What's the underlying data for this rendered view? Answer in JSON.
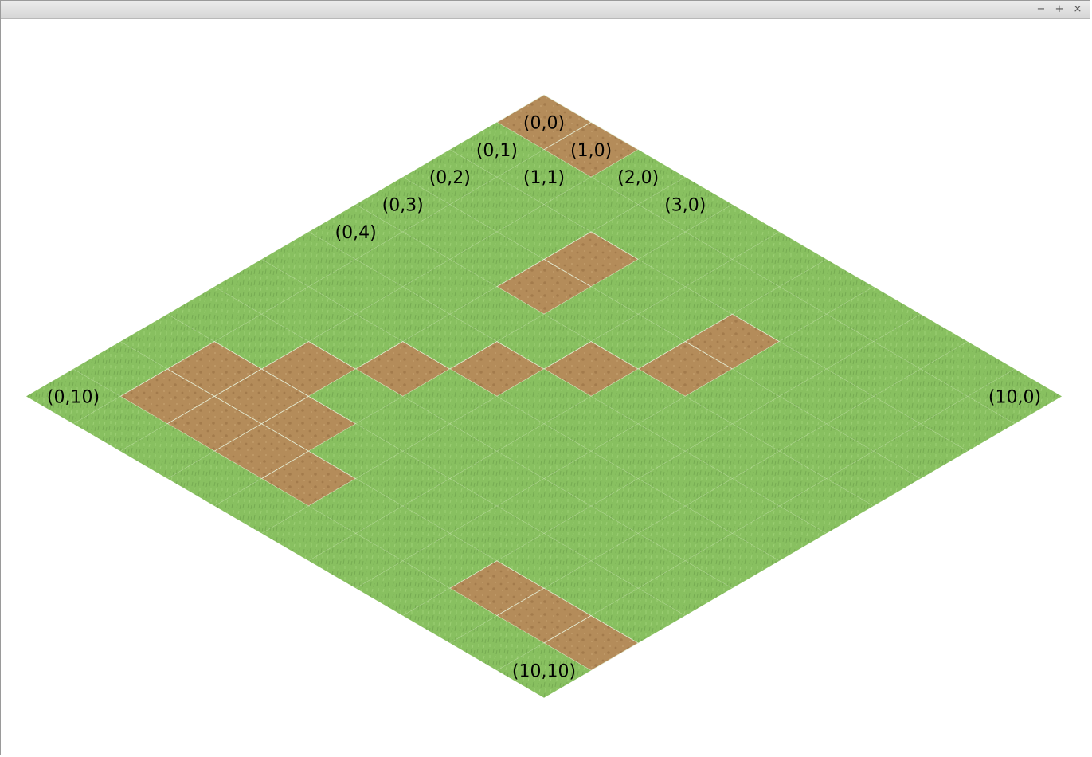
{
  "window": {
    "minimize_icon": "−",
    "maximize_icon": "+",
    "close_icon": "×"
  },
  "map": {
    "grid_size": 10,
    "colors": {
      "grass": "#88c060",
      "grass_dark": "#7aae55",
      "grass_light": "#98cc70",
      "dirt": "#b48c5a",
      "dirt_dark": "#a07a4c",
      "grid_line": "#e9f3dc"
    },
    "dirt_tiles": [
      [
        0,
        0
      ],
      [
        1,
        0
      ],
      [
        3,
        2
      ],
      [
        3,
        3
      ],
      [
        6,
        2
      ],
      [
        6,
        3
      ],
      [
        5,
        4
      ],
      [
        4,
        5
      ],
      [
        3,
        6
      ],
      [
        2,
        7
      ],
      [
        1,
        8
      ],
      [
        2,
        8
      ],
      [
        3,
        8
      ],
      [
        1,
        9
      ],
      [
        2,
        9
      ],
      [
        3,
        9
      ],
      [
        4,
        9
      ],
      [
        8,
        9
      ],
      [
        9,
        9
      ],
      [
        10,
        9
      ]
    ],
    "labels": [
      {
        "text": "(0,0)",
        "tile": [
          0,
          0
        ]
      },
      {
        "text": "(1,0)",
        "tile": [
          1,
          0
        ]
      },
      {
        "text": "(0,1)",
        "tile": [
          0,
          1
        ]
      },
      {
        "text": "(1,1)",
        "tile": [
          1,
          1
        ]
      },
      {
        "text": "(2,0)",
        "tile": [
          2,
          0
        ]
      },
      {
        "text": "(0,2)",
        "tile": [
          0,
          2
        ]
      },
      {
        "text": "(3,0)",
        "tile": [
          3,
          0
        ]
      },
      {
        "text": "(0,3)",
        "tile": [
          0,
          3
        ]
      },
      {
        "text": "(0,4)",
        "tile": [
          0,
          4
        ]
      },
      {
        "text": "(0,10)",
        "tile": [
          0,
          10
        ]
      },
      {
        "text": "(10,0)",
        "tile": [
          10,
          0
        ]
      },
      {
        "text": "(10,10)",
        "tile": [
          10,
          10
        ]
      }
    ]
  }
}
